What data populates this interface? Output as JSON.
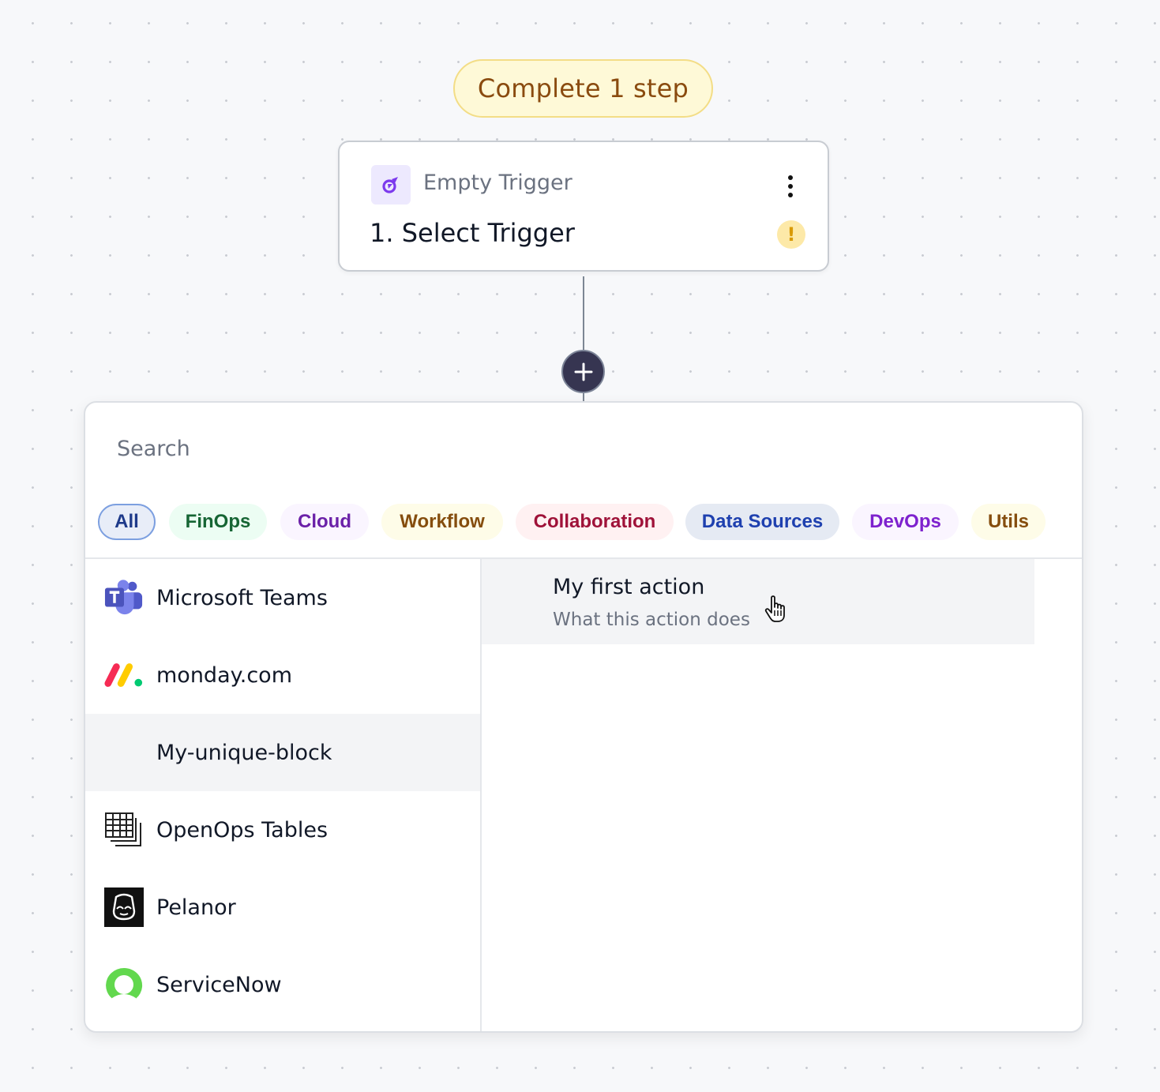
{
  "status": {
    "label": "Complete 1 step"
  },
  "trigger": {
    "subtitle": "Empty Trigger",
    "title": "1. Select Trigger",
    "icon": "trigger-bolt-icon",
    "warning_glyph": "!"
  },
  "picker": {
    "search_placeholder": "Search",
    "chips": [
      {
        "label": "All",
        "fg": "#1e3a8a",
        "bg": "#e8edf8",
        "border": "#7c9fe0",
        "active": true
      },
      {
        "label": "FinOps",
        "fg": "#166534",
        "bg": "#ecfdf3",
        "border": "",
        "active": false
      },
      {
        "label": "Cloud",
        "fg": "#6b21a8",
        "bg": "#faf5ff",
        "border": "",
        "active": false
      },
      {
        "label": "Workflow",
        "fg": "#854d0e",
        "bg": "#fefce8",
        "border": "",
        "active": false
      },
      {
        "label": "Collaboration",
        "fg": "#9f1239",
        "bg": "#fff1f2",
        "border": "",
        "active": false
      },
      {
        "label": "Data Sources",
        "fg": "#1e40af",
        "bg": "#e5eaf3",
        "border": "",
        "active": false
      },
      {
        "label": "DevOps",
        "fg": "#7e22ce",
        "bg": "#faf5ff",
        "border": "",
        "active": false
      },
      {
        "label": "Utils",
        "fg": "#854d0e",
        "bg": "#fefce8",
        "border": "",
        "active": false
      }
    ],
    "blocks": [
      {
        "label": "Microsoft Teams",
        "icon": "microsoft-teams-logo"
      },
      {
        "label": "monday.com",
        "icon": "monday-logo"
      },
      {
        "label": "My-unique-block",
        "icon": "",
        "selected": true
      },
      {
        "label": "OpenOps Tables",
        "icon": "tables-icon"
      },
      {
        "label": "Pelanor",
        "icon": "pelanor-logo"
      },
      {
        "label": "ServiceNow",
        "icon": "servicenow-logo"
      }
    ],
    "actions": [
      {
        "title": "My first action",
        "description": "What this action does"
      }
    ]
  },
  "colors": {
    "accent_dark": "#363551",
    "warning": "#d99a06",
    "status_bg": "#fef9d7"
  }
}
